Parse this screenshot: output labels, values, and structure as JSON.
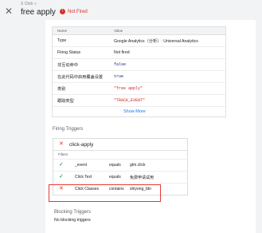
{
  "header": {
    "breadcrumb": "S Click »",
    "title": "free apply",
    "status": "Not Fired",
    "close_icon": "close-icon",
    "status_icon": "error-icon"
  },
  "properties": {
    "col_name": "Name",
    "col_value": "Value",
    "rows": [
      {
        "key": "Type",
        "value": "Google Analytics（分析）: Universal Analytics"
      },
      {
        "key": "Firing Status",
        "value": "Not fired"
      },
      {
        "key": "非互动命中",
        "value": "false"
      },
      {
        "key": "在此代码中启用覆盖设置",
        "value": "true"
      },
      {
        "key": "类别",
        "value": "\"free apply\""
      },
      {
        "key": "跟踪类型",
        "value": "\"TRACK_EVENT\""
      }
    ],
    "show_more": "Show More"
  },
  "firing": {
    "title": "Firing Triggers",
    "trigger_name": "click-apply",
    "filters_label": "Filters",
    "filters": [
      {
        "status": "pass",
        "variable": "_event",
        "operator": "equals",
        "value": "gtm.click"
      },
      {
        "status": "pass",
        "variable": "Click Text",
        "operator": "equals",
        "value": "免费申请试用"
      },
      {
        "status": "fail",
        "variable": "Click Classes",
        "operator": "contains",
        "value": "shiyong_btn"
      }
    ]
  },
  "blocking": {
    "title": "Blocking Triggers",
    "empty_text": "No blocking triggers"
  },
  "colors": {
    "error": "#d93025",
    "success": "#188038",
    "link": "#1a73e8",
    "highlight": "#e53935"
  }
}
